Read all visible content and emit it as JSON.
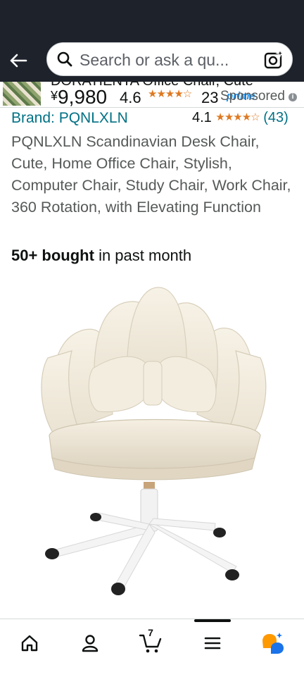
{
  "search": {
    "placeholder": "Search or ask a qu..."
  },
  "sponsored_strip": {
    "title": "DORATIENTA Office Chair, Cute",
    "currency": "¥",
    "price": "9,980",
    "rating": "4.6",
    "stars": "★★★★☆",
    "review_count": "23",
    "prime": "prime",
    "sponsored_label": "Sponsored",
    "info_glyph": "i"
  },
  "product": {
    "brand": "Brand: PQNLXLN",
    "rating": "4.1",
    "stars": "★★★★☆",
    "review_count": "(43)",
    "title": "PQNLXLN Scandinavian Desk Chair, Cute, Home Office Chair, Stylish, Computer Chair, Study Chair, Work Chair, 360 Rotation, with Elevating Function",
    "bought_count": "50+ bought",
    "bought_suffix": " in past month"
  },
  "bottom_nav": {
    "items": [
      {
        "name": "home",
        "icon": "home-icon"
      },
      {
        "name": "account",
        "icon": "person-icon"
      },
      {
        "name": "cart",
        "icon": "cart-icon",
        "count": "7"
      },
      {
        "name": "menu",
        "icon": "menu-icon"
      },
      {
        "name": "rufus",
        "icon": "ai-assistant-icon"
      }
    ]
  },
  "colors": {
    "header_bg": "#1d222b",
    "link": "#007185",
    "star": "#de7921",
    "prime": "#1a98ff",
    "assistant_orange": "#ff9900",
    "assistant_blue": "#1a73e8"
  }
}
